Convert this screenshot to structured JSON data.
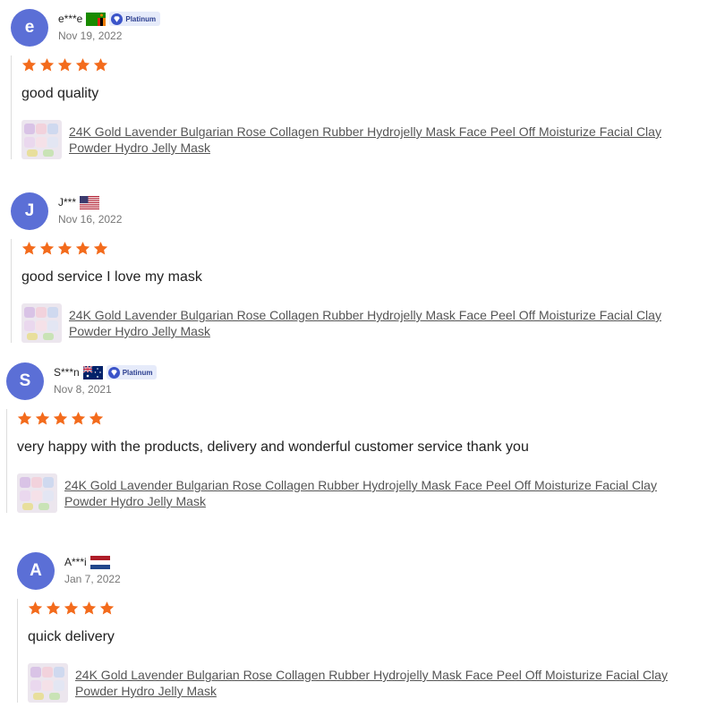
{
  "reviews": [
    {
      "avatar_letter": "e",
      "username": "e***e",
      "flag": "zambia",
      "badge": "Platinum",
      "date": "Nov 19, 2022",
      "rating": 5,
      "text": "good quality",
      "product": "24K Gold Lavender Bulgarian Rose Collagen Rubber Hydrojelly Mask Face Peel Off Moisturize Facial Clay Powder Hydro Jelly Mask"
    },
    {
      "avatar_letter": "J",
      "username": "J***",
      "flag": "usa",
      "badge": "",
      "date": "Nov 16, 2022",
      "rating": 5,
      "text": "good service I love my mask",
      "product": "24K Gold Lavender Bulgarian Rose Collagen Rubber Hydrojelly Mask Face Peel Off Moisturize Facial Clay Powder Hydro Jelly Mask"
    },
    {
      "avatar_letter": "S",
      "username": "S***n",
      "flag": "australia",
      "badge": "Platinum",
      "date": "Nov 8, 2021",
      "rating": 5,
      "text": "very happy with the products, delivery and wonderful customer service thank you",
      "product": "24K Gold Lavender Bulgarian Rose Collagen Rubber Hydrojelly Mask Face Peel Off Moisturize Facial Clay Powder Hydro Jelly Mask"
    },
    {
      "avatar_letter": "A",
      "username": "A***i",
      "flag": "netherlands",
      "badge": "",
      "date": "Jan 7, 2022",
      "rating": 5,
      "text": "quick delivery",
      "product": "24K Gold Lavender Bulgarian Rose Collagen Rubber Hydrojelly Mask Face Peel Off Moisturize Facial Clay Powder Hydro Jelly Mask"
    }
  ],
  "colors": {
    "avatar": "#5b6fd6",
    "star": "#f36b1c",
    "badge_bg": "#e6ebfa",
    "badge_text": "#2a3d8f"
  },
  "icons": {
    "star": "star-icon",
    "badge": "diamond-icon"
  }
}
